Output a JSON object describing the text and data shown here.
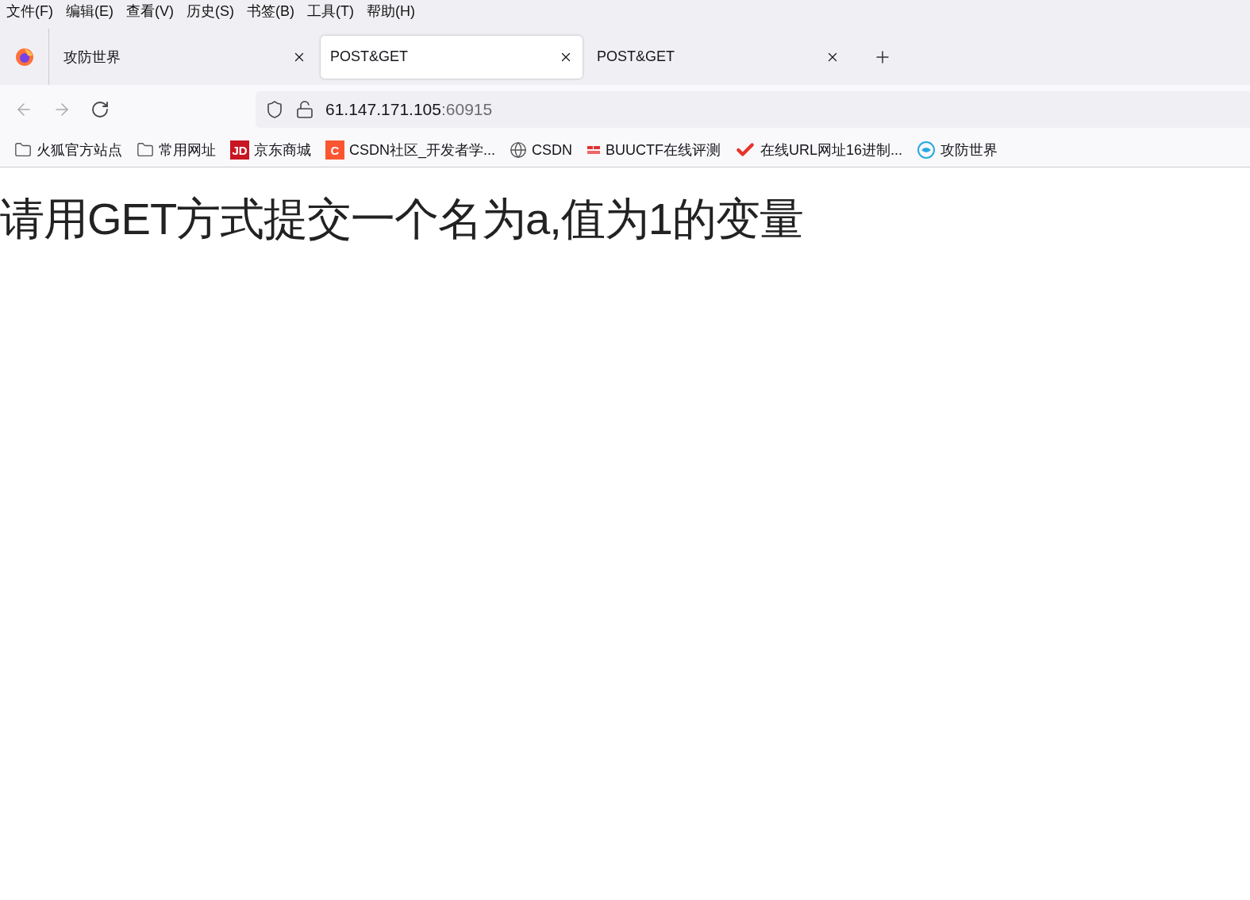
{
  "menu": [
    "文件(F)",
    "编辑(E)",
    "查看(V)",
    "历史(S)",
    "书签(B)",
    "工具(T)",
    "帮助(H)"
  ],
  "tabs": [
    {
      "title": "攻防世界",
      "selected": false
    },
    {
      "title": "POST&GET",
      "selected": true
    },
    {
      "title": "POST&GET",
      "selected": false
    }
  ],
  "address": {
    "host": "61.147.171.105",
    "port": ":60915"
  },
  "bookmarks": [
    {
      "kind": "folder",
      "label": "火狐官方站点"
    },
    {
      "kind": "folder",
      "label": "常用网址"
    },
    {
      "kind": "badge",
      "badge": "JD",
      "color": "#c81623",
      "label": "京东商城"
    },
    {
      "kind": "badge",
      "badge": "C",
      "color": "#fc5531",
      "label": "CSDN社区_开发者学..."
    },
    {
      "kind": "globe",
      "label": "CSDN"
    },
    {
      "kind": "flag",
      "label": "BUUCTF在线评测"
    },
    {
      "kind": "check",
      "label": "在线URL网址16进制..."
    },
    {
      "kind": "logo",
      "label": "攻防世界"
    }
  ],
  "page": {
    "heading": "请用GET方式提交一个名为a,值为1的变量"
  }
}
